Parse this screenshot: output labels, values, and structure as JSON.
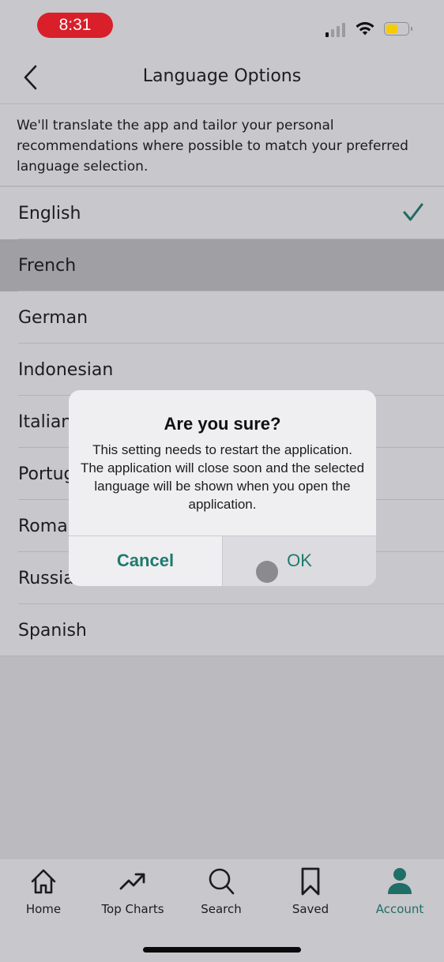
{
  "status_bar": {
    "time": "8:31",
    "signal_icon": "cellular-signal-icon",
    "wifi_icon": "wifi-icon",
    "battery_icon": "battery-icon",
    "battery_level": 0.55,
    "time_pill_color": "#d81f2a"
  },
  "nav": {
    "back_icon": "chevron-left-icon",
    "title": "Language Options"
  },
  "intro_text": "We'll translate the app and tailor your personal recommendations where possible to match your preferred language selection.",
  "languages": [
    {
      "label": "English",
      "selected": true
    },
    {
      "label": "French",
      "pressed": true
    },
    {
      "label": "German"
    },
    {
      "label": "Indonesian"
    },
    {
      "label": "Italian"
    },
    {
      "label": "Portuguese"
    },
    {
      "label": "Romanian"
    },
    {
      "label": "Russian"
    },
    {
      "label": "Spanish"
    }
  ],
  "dialog": {
    "title": "Are you sure?",
    "message": "This setting needs to restart the application. The application will close soon and the selected language will be shown when you open the application.",
    "cancel_label": "Cancel",
    "ok_label": "OK"
  },
  "tab_bar": {
    "items": [
      {
        "label": "Home",
        "icon": "home-icon"
      },
      {
        "label": "Top Charts",
        "icon": "trending-up-icon"
      },
      {
        "label": "Search",
        "icon": "search-icon"
      },
      {
        "label": "Saved",
        "icon": "bookmark-icon"
      },
      {
        "label": "Account",
        "icon": "person-icon",
        "active": true
      }
    ]
  },
  "colors": {
    "accent": "#1e7a6f",
    "active_tab": "#1f6e67",
    "background": "#c8c7cb"
  }
}
